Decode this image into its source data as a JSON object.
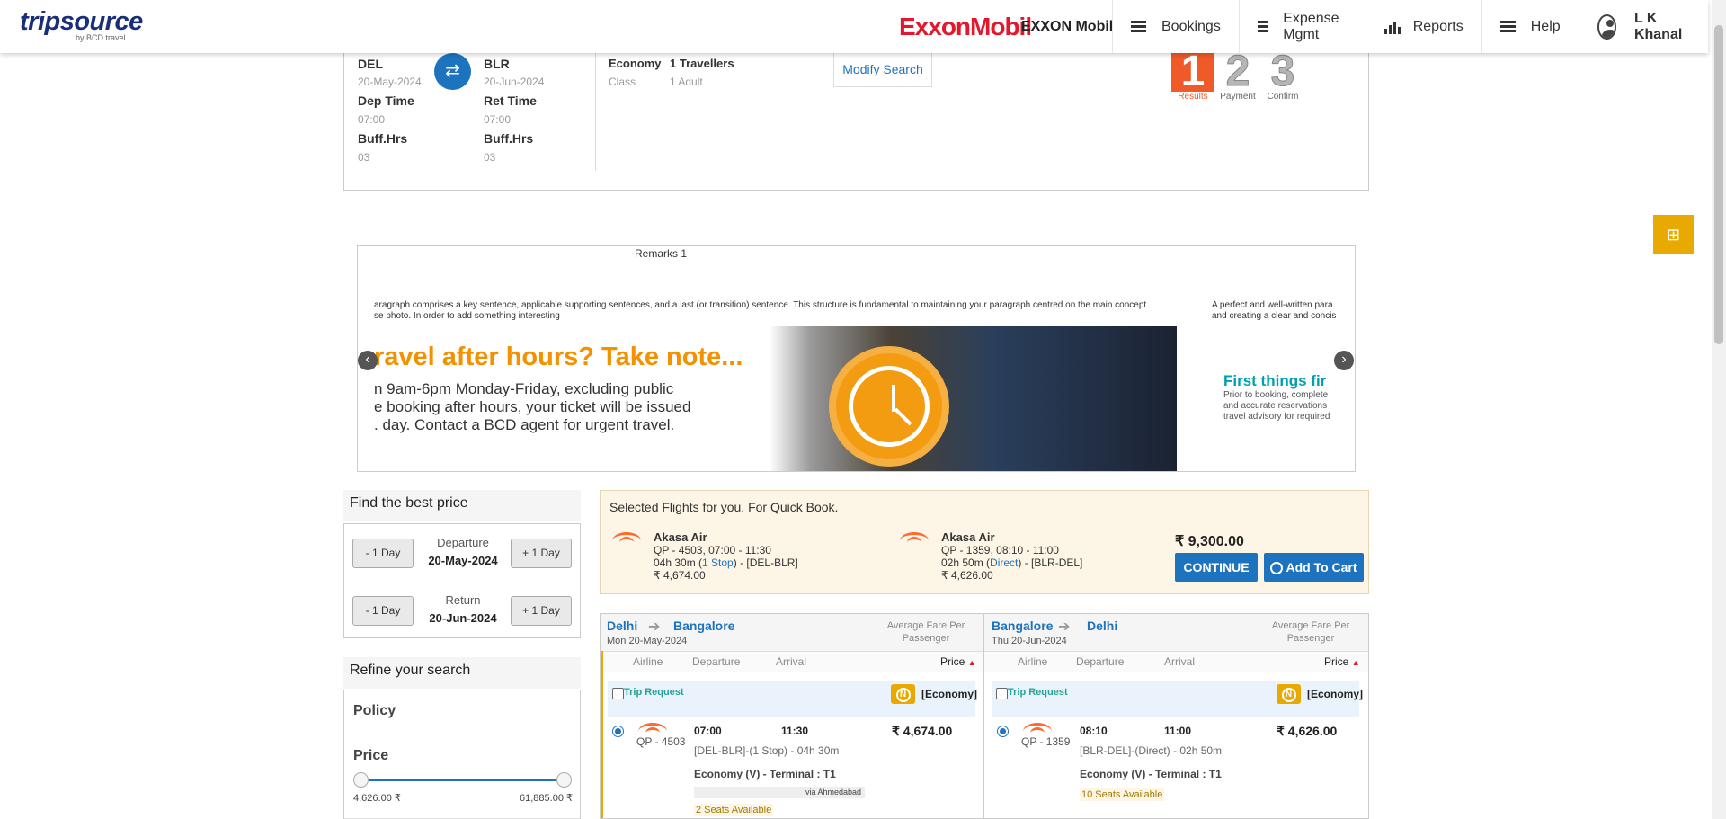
{
  "header": {
    "logo_main": "tripsource",
    "logo_sub": "by BCD travel",
    "brand_logo": "ExxonMobil",
    "company": "EXXON Mobil",
    "nav": [
      {
        "label": "Bookings",
        "icon": "menu-icon"
      },
      {
        "label": "Expense Mgmt",
        "icon": "menu-icon"
      },
      {
        "label": "Reports",
        "icon": "bar-chart-icon"
      },
      {
        "label": "Help",
        "icon": "menu-icon"
      }
    ],
    "user_name": "L K Khanal"
  },
  "search": {
    "from_code": "DEL",
    "from_date": "20-May-2024",
    "to_code": "BLR",
    "to_date": "20-Jun-2024",
    "dep_time_label": "Dep Time",
    "dep_time": "07:00",
    "ret_time_label": "Ret Time",
    "ret_time": "07:00",
    "buff_label": "Buff.Hrs",
    "buff_dep": "03",
    "buff_ret": "03",
    "class_value": "Economy",
    "class_label": "Class",
    "travellers_value": "1 Travellers",
    "travellers_label": "1 Adult",
    "modify_label": "Modify Search"
  },
  "steps": [
    {
      "num": "1",
      "label": "Results",
      "color": "#f05a28",
      "active": true
    },
    {
      "num": "2",
      "label": "Payment",
      "color": "#b5b5b5",
      "active": false
    },
    {
      "num": "3",
      "label": "Confirm",
      "color": "#b5b5b5",
      "active": false
    }
  ],
  "remarks": {
    "title": "Remarks 1",
    "text_line1": "aragraph comprises a key sentence, applicable supporting sentences, and a last (or transition) sentence. This structure is fundamental to maintaining your paragraph centred on the main concept",
    "text_line2": "se photo. In order to add something interesting",
    "text2_line1": "A perfect and well-written para",
    "text2_line2": "and creating a clear and concis",
    "banner_heading": "ravel after hours? Take note...",
    "banner_line1": "n 9am-6pm Monday-Friday, excluding public",
    "banner_line2": "e booking after hours, your ticket will be issued",
    "banner_line3": ". day. Contact a BCD agent for urgent travel.",
    "banner2_heading": "First things fir",
    "banner2_line1": "Prior to booking, complete",
    "banner2_line2": "and accurate reservations",
    "banner2_line3": "travel advisory for required"
  },
  "price_finder": {
    "title": "Find the best price",
    "minus_label": "- 1 Day",
    "plus_label": "+ 1 Day",
    "departure_label": "Departure",
    "departure_date": "20-May-2024",
    "return_label": "Return",
    "return_date": "20-Jun-2024"
  },
  "refine": {
    "title": "Refine your search",
    "policy_label": "Policy",
    "price_label": "Price",
    "price_min": "4,626.00 ₹",
    "price_max": "61,885.00 ₹"
  },
  "quick_book": {
    "title": "Selected Flights for you. For Quick Book.",
    "outbound": {
      "airline": "Akasa Air",
      "flight": "QP - 4503, 07:00 - 11:30",
      "duration": "04h 30m (",
      "stops": "1 Stop",
      "route": ") - [DEL-BLR]",
      "price": "₹ 4,674.00"
    },
    "inbound": {
      "airline": "Akasa Air",
      "flight": "QP - 1359, 08:10 - 11:00",
      "duration": "02h 50m (",
      "stops": "Direct",
      "route": ") - [BLR-DEL]",
      "price": "₹ 4,626.00"
    },
    "total": "₹ 9,300.00",
    "continue_label": "CONTINUE",
    "cart_label": "Add To Cart"
  },
  "lists": [
    {
      "from": "Delhi",
      "to": "Bangalore",
      "date": "Mon 20-May-2024",
      "avg_label": "Average Fare Per Passenger",
      "cols": {
        "airline": "Airline",
        "departure": "Departure",
        "arrival": "Arrival",
        "price": "Price"
      },
      "request_label": "Trip Request",
      "class_tag": "[Economy]",
      "flight": {
        "number": "QP - 4503",
        "dep": "07:00",
        "arr": "11:30",
        "price": "₹ 4,674.00",
        "route": "[DEL-BLR]-(1 Stop) - 04h 30m",
        "cabin": "Economy (V) - Terminal : T1",
        "via": "via Ahmedabad",
        "seats": "2 Seats Available"
      }
    },
    {
      "from": "Bangalore",
      "to": "Delhi",
      "date": "Thu 20-Jun-2024",
      "avg_label": "Average Fare Per Passenger",
      "cols": {
        "airline": "Airline",
        "departure": "Departure",
        "arrival": "Arrival",
        "price": "Price"
      },
      "request_label": "Trip Request",
      "class_tag": "[Economy]",
      "flight": {
        "number": "QP - 1359",
        "dep": "08:10",
        "arr": "11:00",
        "price": "₹ 4,626.00",
        "route": "[BLR-DEL]-(Direct) - 02h 50m",
        "cabin": "Economy (V) - Terminal : T1",
        "seats": "10 Seats Available"
      }
    }
  ],
  "colors": {
    "primary": "#1e73be",
    "accent": "#e8a900",
    "brand": "#e3182d",
    "step_active": "#f05a28"
  }
}
